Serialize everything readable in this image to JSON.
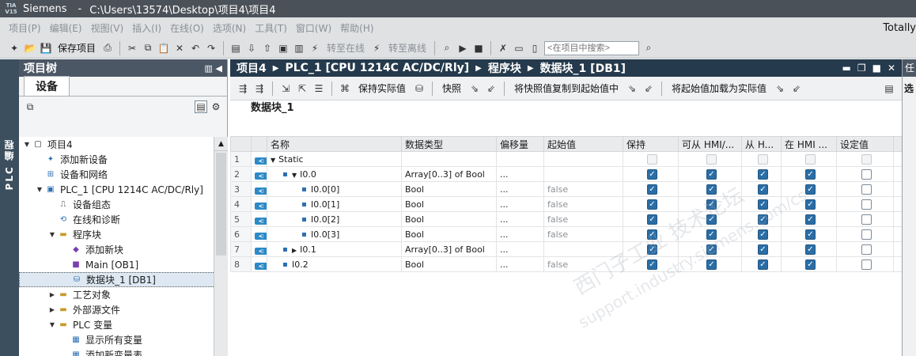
{
  "window": {
    "app": "Siemens",
    "path": "C:\\Users\\13574\\Desktop\\项目4\\项目4",
    "logo": "TIA V15"
  },
  "menu": [
    "项目(P)",
    "编辑(E)",
    "视图(V)",
    "插入(I)",
    "在线(O)",
    "选项(N)",
    "工具(T)",
    "窗口(W)",
    "帮助(H)"
  ],
  "right_brand": "Totally",
  "toolbar": {
    "save_label": "保存项目",
    "go_online": "转至在线",
    "go_offline": "转至离线",
    "search_placeholder": "<在项目中搜索>"
  },
  "left_strip_label": "PLC 编程",
  "project_tree": {
    "title": "项目树",
    "tab": "设备",
    "items": [
      {
        "label": "项目4",
        "icon": "project-icon"
      },
      {
        "label": "添加新设备",
        "icon": "add-device-icon"
      },
      {
        "label": "设备和网络",
        "icon": "network-icon"
      },
      {
        "label": "PLC_1 [CPU 1214C AC/DC/Rly]",
        "icon": "plc-icon"
      },
      {
        "label": "设备组态",
        "icon": "config-icon"
      },
      {
        "label": "在线和诊断",
        "icon": "diagnostics-icon"
      },
      {
        "label": "程序块",
        "icon": "folder-icon"
      },
      {
        "label": "添加新块",
        "icon": "add-block-icon"
      },
      {
        "label": "Main [OB1]",
        "icon": "ob-icon"
      },
      {
        "label": "数据块_1 [DB1]",
        "icon": "db-icon"
      },
      {
        "label": "工艺对象",
        "icon": "folder-icon"
      },
      {
        "label": "外部源文件",
        "icon": "folder-icon"
      },
      {
        "label": "PLC 变量",
        "icon": "folder-icon"
      },
      {
        "label": "显示所有变量",
        "icon": "tags-icon"
      },
      {
        "label": "添加新变量表",
        "icon": "add-tagtable-icon"
      }
    ]
  },
  "editor": {
    "breadcrumb": [
      "项目4",
      "PLC_1 [CPU 1214C AC/DC/Rly]",
      "程序块",
      "数据块_1 [DB1]"
    ],
    "toolbar": {
      "keep_actual": "保持实际值",
      "snapshot": "快照",
      "copy_snapshot": "将快照值复制到起始值中",
      "load_start": "将起始值加载为实际值"
    },
    "block_title": "数据块_1",
    "columns": [
      "名称",
      "数据类型",
      "偏移量",
      "起始值",
      "保持",
      "可从 HMI/...",
      "从 H...",
      "在 HMI ...",
      "设定值"
    ],
    "rows": [
      {
        "num": "1",
        "name": "Static",
        "type": "",
        "offset": "",
        "start": "",
        "retain": false,
        "hmi1": false,
        "hmi2": false,
        "hmi3": false,
        "setpoint": false,
        "level": 0,
        "expand": "open",
        "bullet": false,
        "disabled": true
      },
      {
        "num": "2",
        "name": "I0.0",
        "type": "Array[0..3] of Bool",
        "offset": "...",
        "start": "",
        "retain": true,
        "hmi1": true,
        "hmi2": true,
        "hmi3": true,
        "setpoint": false,
        "level": 1,
        "expand": "open",
        "bullet": true,
        "disabled": false
      },
      {
        "num": "3",
        "name": "I0.0[0]",
        "type": "Bool",
        "offset": "...",
        "start": "false",
        "retain": true,
        "hmi1": true,
        "hmi2": true,
        "hmi3": true,
        "setpoint": false,
        "level": 2,
        "expand": "",
        "bullet": true,
        "disabled": false
      },
      {
        "num": "4",
        "name": "I0.0[1]",
        "type": "Bool",
        "offset": "...",
        "start": "false",
        "retain": true,
        "hmi1": true,
        "hmi2": true,
        "hmi3": true,
        "setpoint": false,
        "level": 2,
        "expand": "",
        "bullet": true,
        "disabled": false
      },
      {
        "num": "5",
        "name": "I0.0[2]",
        "type": "Bool",
        "offset": "...",
        "start": "false",
        "retain": true,
        "hmi1": true,
        "hmi2": true,
        "hmi3": true,
        "setpoint": false,
        "level": 2,
        "expand": "",
        "bullet": true,
        "disabled": false
      },
      {
        "num": "6",
        "name": "I0.0[3]",
        "type": "Bool",
        "offset": "...",
        "start": "false",
        "retain": true,
        "hmi1": true,
        "hmi2": true,
        "hmi3": true,
        "setpoint": false,
        "level": 2,
        "expand": "",
        "bullet": true,
        "disabled": false
      },
      {
        "num": "7",
        "name": "I0.1",
        "type": "Array[0..3] of Bool",
        "offset": "...",
        "start": "",
        "retain": true,
        "hmi1": true,
        "hmi2": true,
        "hmi3": true,
        "setpoint": false,
        "level": 1,
        "expand": "closed",
        "bullet": true,
        "disabled": false
      },
      {
        "num": "8",
        "name": "I0.2",
        "type": "Bool",
        "offset": "...",
        "start": "false",
        "retain": true,
        "hmi1": true,
        "hmi2": true,
        "hmi3": true,
        "setpoint": false,
        "level": 1,
        "expand": "",
        "bullet": true,
        "disabled": false
      }
    ]
  },
  "right_panel": {
    "title": "任",
    "label": "选"
  },
  "watermark": {
    "line1": "西门子工业 技术论坛",
    "line2": "support.industry.siemens.com/cs"
  },
  "colors": {
    "accent": "#2b6ea6",
    "header_dark": "#253a4c",
    "panel_head": "#4c5765"
  }
}
